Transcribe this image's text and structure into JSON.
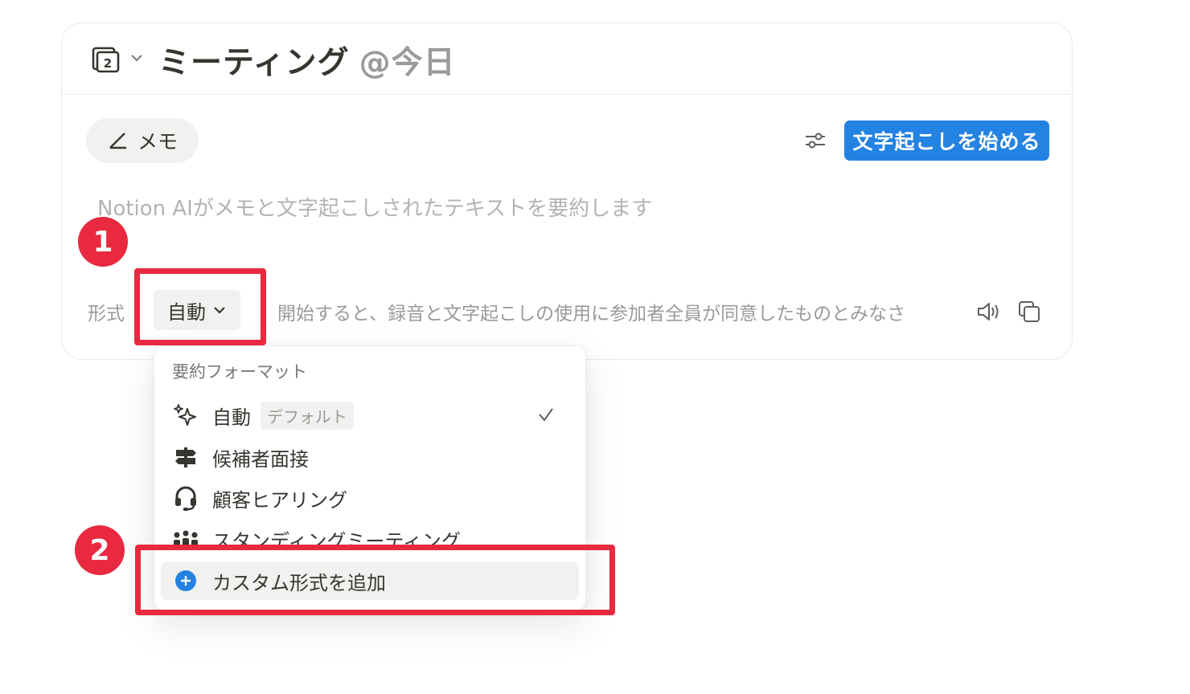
{
  "header": {
    "title": "ミーティング",
    "date_mention": "@今日"
  },
  "toolbar": {
    "memo_label": "メモ",
    "start_transcription_label": "文字起こしを始める"
  },
  "body": {
    "placeholder": "Notion AIがメモと文字起こしされたテキストを要約します"
  },
  "format_bar": {
    "label": "形式",
    "selected": "自動",
    "consent_text": "開始すると、録音と文字起こしの使用に参加者全員が同意したものとみなさ"
  },
  "dropdown": {
    "heading": "要約フォーマット",
    "items": [
      {
        "label": "自動",
        "badge": "デフォルト",
        "icon": "sparkle-icon",
        "selected": true
      },
      {
        "label": "候補者面接",
        "icon": "signpost-icon"
      },
      {
        "label": "顧客ヒアリング",
        "icon": "headset-icon"
      },
      {
        "label": "スタンディングミーティング",
        "icon": "people-icon"
      }
    ],
    "add_label": "カスタム形式を追加"
  },
  "annotations": {
    "step1": "1",
    "step2": "2",
    "highlight_color": "#e8293f"
  },
  "colors": {
    "accent": "#2383e2"
  }
}
